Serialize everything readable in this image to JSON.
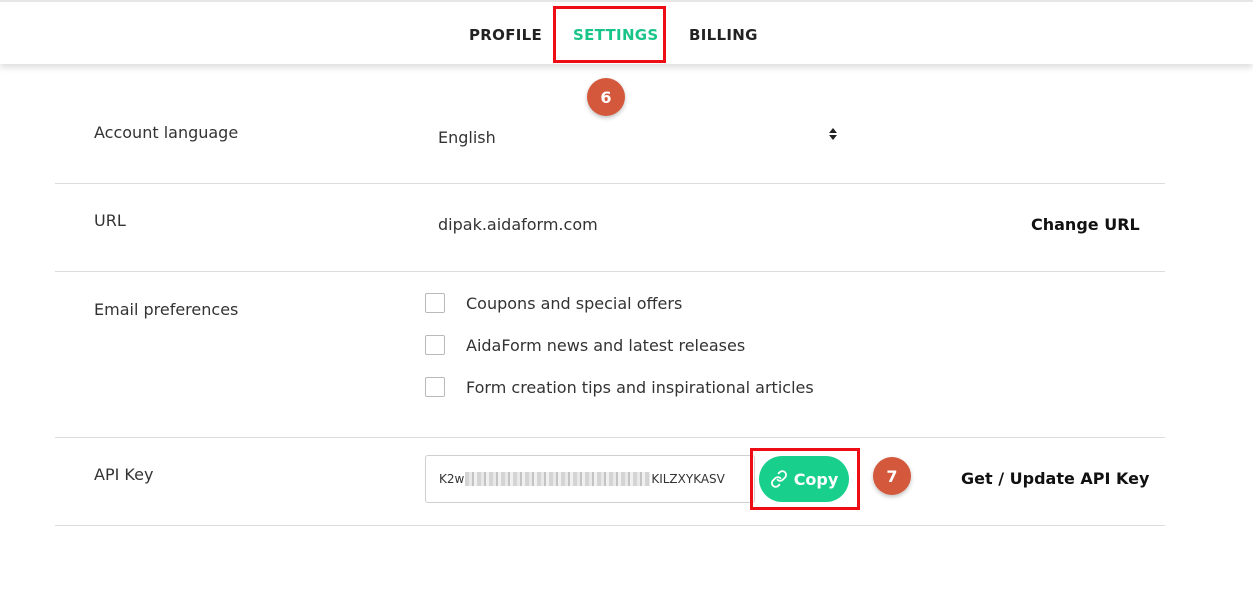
{
  "tabs": {
    "profile": "PROFILE",
    "settings": "SETTINGS",
    "billing": "BILLING",
    "active": "SETTINGS"
  },
  "annotations": {
    "step6": "6",
    "step7": "7"
  },
  "account_language": {
    "label": "Account language",
    "value": "English"
  },
  "url": {
    "label": "URL",
    "value": "dipak.aidaform.com",
    "action": "Change URL"
  },
  "email_preferences": {
    "label": "Email preferences",
    "options": [
      {
        "label": "Coupons and special offers",
        "checked": false
      },
      {
        "label": "AidaForm news and latest releases",
        "checked": false
      },
      {
        "label": "Form creation tips and inspirational articles",
        "checked": false
      }
    ]
  },
  "api_key": {
    "label": "API Key",
    "value_prefix": "K2w",
    "value_suffix": "KILZXYKASV",
    "copy_label": "Copy",
    "action": "Get / Update API Key"
  },
  "colors": {
    "accent": "#19cf8c",
    "highlight": "#ee0d14",
    "badge": "#d4583c"
  }
}
